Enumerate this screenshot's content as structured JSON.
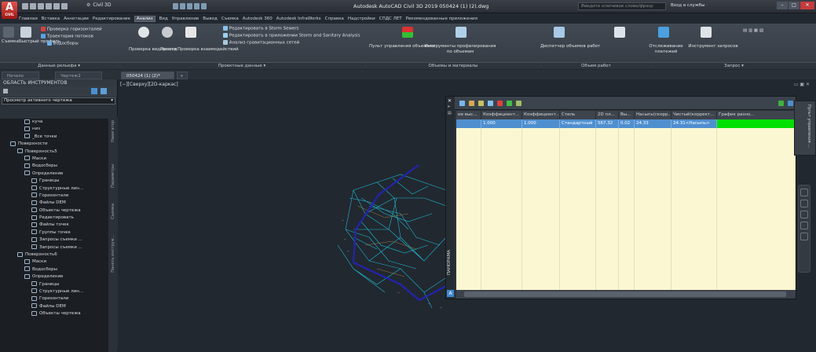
{
  "app": {
    "logo": "A",
    "logo_sub": "CIVIL",
    "window_title": "Autodesk AutoCAD Civil 3D 2019  050424 (1) (2).dwg"
  },
  "workspace": {
    "label": "Civil 3D"
  },
  "search": {
    "placeholder": "Введите ключевое слово/фразу"
  },
  "signin": {
    "label": "Вход в службы"
  },
  "menu_tabs": [
    "Главная",
    "Вставка",
    "Аннотации",
    "Редактирование",
    "Анализ",
    "Вид",
    "Управление",
    "Вывод",
    "Съемка",
    "Autodesk 360",
    "Autodesk InfraWorks",
    "Справка",
    "Надстройки",
    "СПДС ЛЕТ",
    "Рекомендованные приложения"
  ],
  "active_tab": "Анализ",
  "ribbon": {
    "survey": "Съемка",
    "quick_profile": "Быстрый профиль",
    "flow_paths": "Траектория потоков",
    "water_drop": "Водосборы",
    "contour_check": "Проверка горизонталей",
    "visibility_check": "Проверка видимости",
    "pass": "Проход",
    "interaction_check": "Проверка взаимодействий",
    "storm_sewers": "Редактировать в Storm Sewers",
    "storm_sanitary": "Редактировать в приложении Storm and Sanitary Analysis",
    "gravity_network": "Анализ гравитационных сетей",
    "volumes_dashboard": "Пульт управления объемами",
    "profile_volumes": "Инструменты профилирования по объемам",
    "volume_dispatcher": "Диспетчер объемов работ",
    "track_payments": "Отслеживание платежей",
    "query_tool": "Инструмент запросов",
    "panels": {
      "ground_data": "Данные рельефа ▾",
      "design_data": "Проектные данные ▾",
      "volumes_materials": "Объемы и материалы",
      "volume_work": "Объем работ",
      "query": "Запрос ▾"
    }
  },
  "doc_tabs": [
    "Начало",
    "Чертеж2",
    "050424 (1) (2)*"
  ],
  "viewport": {
    "label": "[−][Сверху][2D-каркас]"
  },
  "toolspace": {
    "title": "ОБЛАСТЬ ИНСТРУМЕНТОВ",
    "selector": "Просмотр активного чертежа",
    "vtabs": [
      "Навигатор",
      "Параметры",
      "Съемка",
      "Панель инструм..."
    ],
    "tree": [
      {
        "label": "куча",
        "indent": 3
      },
      {
        "label": "низ",
        "indent": 3
      },
      {
        "label": "_Все точки",
        "indent": 3
      },
      {
        "label": "Поверхности",
        "indent": 1
      },
      {
        "label": "Поверхность5",
        "indent": 2
      },
      {
        "label": "Маски",
        "indent": 3
      },
      {
        "label": "Водосборы",
        "indent": 3
      },
      {
        "label": "Определение",
        "indent": 3
      },
      {
        "label": "Границы",
        "indent": 4
      },
      {
        "label": "Структурные лин...",
        "indent": 4
      },
      {
        "label": "Горизонтали",
        "indent": 4
      },
      {
        "label": "Файлы DEM",
        "indent": 4
      },
      {
        "label": "Объекты чертежа",
        "indent": 4
      },
      {
        "label": "Редактировать",
        "indent": 4
      },
      {
        "label": "Файлы точек",
        "indent": 4
      },
      {
        "label": "Группы точек",
        "indent": 4
      },
      {
        "label": "Запросы съемки ...",
        "indent": 4
      },
      {
        "label": "Запросы съемки ...",
        "indent": 4
      },
      {
        "label": "Поверхность6",
        "indent": 2
      },
      {
        "label": "Маски",
        "indent": 3
      },
      {
        "label": "Водосборы",
        "indent": 3
      },
      {
        "label": "Определение",
        "indent": 3
      },
      {
        "label": "Границы",
        "indent": 4
      },
      {
        "label": "Структурные лин...",
        "indent": 4
      },
      {
        "label": "Горизонтали",
        "indent": 4
      },
      {
        "label": "Файлы DEM",
        "indent": 4
      },
      {
        "label": "Объекты чертежа",
        "indent": 4
      }
    ]
  },
  "table": {
    "side_label": "ПАНОРАМА",
    "prop_label": "Пульт управления ...",
    "headers": [
      "ие выс...",
      "Коэффициент...",
      "Коэффициент...",
      "Стиль",
      "2D пл...",
      "Вы...",
      "Насыпь(скорр...",
      "Чистый(коррект...",
      "График разно..."
    ],
    "row": [
      "",
      "1.000",
      "1.000",
      "Стандартный",
      "567.32",
      "0.02",
      "24.33",
      "24.31<Насыпь>",
      ""
    ]
  },
  "colors": {
    "surface_mesh": "#1ec9e3",
    "boundary": "#2020b0",
    "row_highlight": "#4f8fd0",
    "graph_cell": "#00e000"
  }
}
